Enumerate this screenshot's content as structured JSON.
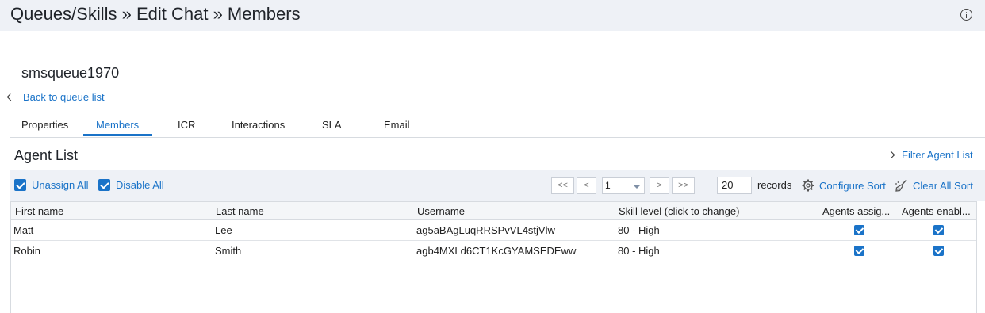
{
  "header": {
    "title": "Queues/Skills » Edit Chat » Members",
    "info_icon": "info-icon"
  },
  "queue": {
    "name": "smsqueue1970",
    "back_link": "Back to queue list"
  },
  "tabs": [
    {
      "label": "Properties",
      "active": false
    },
    {
      "label": "Members",
      "active": true
    },
    {
      "label": "ICR",
      "active": false
    },
    {
      "label": "Interactions",
      "active": false
    },
    {
      "label": "SLA",
      "active": false
    },
    {
      "label": "Email",
      "active": false
    }
  ],
  "agent_list": {
    "title": "Agent List",
    "filter_link": "Filter Agent List",
    "toolbar": {
      "unassign_all": "Unassign All",
      "disable_all": "Disable All",
      "unassign_all_checked": true,
      "disable_all_checked": true,
      "first_label": "<<",
      "prev_label": "<",
      "page_value": "1",
      "next_label": ">",
      "last_label": ">>",
      "records_value": "20",
      "records_label": "records",
      "configure_sort": "Configure Sort",
      "clear_all_sort": "Clear All Sort"
    },
    "columns": [
      "First name",
      "Last name",
      "Username",
      "Skill level (click to change)",
      "Agents assig...",
      "Agents enabl..."
    ],
    "rows": [
      {
        "first_name": "Matt",
        "last_name": "Lee",
        "username": "ag5aBAgLuqRRSPvVL4stjVlw",
        "skill_level": "80 - High",
        "assigned": true,
        "enabled": true
      },
      {
        "first_name": "Robin",
        "last_name": "Smith",
        "username": "agb4MXLd6CT1KcGYAMSEDEww",
        "skill_level": "80 - High",
        "assigned": true,
        "enabled": true
      }
    ]
  },
  "colors": {
    "accent": "#1a73c8",
    "header_bg": "#eef1f6",
    "border": "#d7dbe0"
  }
}
